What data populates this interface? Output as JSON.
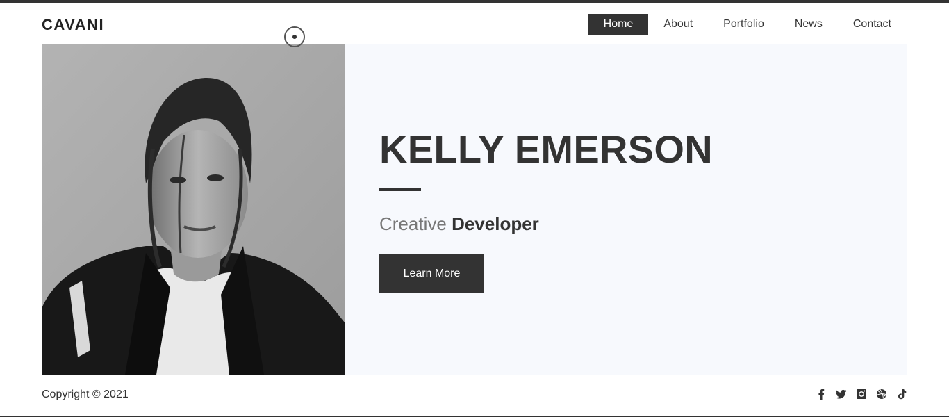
{
  "brand": {
    "name": "CAVANI"
  },
  "nav": {
    "items": [
      {
        "label": "Home",
        "active": true
      },
      {
        "label": "About",
        "active": false
      },
      {
        "label": "Portfolio",
        "active": false
      },
      {
        "label": "News",
        "active": false
      },
      {
        "label": "Contact",
        "active": false
      }
    ]
  },
  "hero": {
    "name": "KELLY EMERSON",
    "job_light": "Creative",
    "job_bold": "Developer",
    "button_label": "Learn More",
    "portrait_icon": "portrait-photo"
  },
  "footer": {
    "copyright": "Copyright © 2021",
    "social": [
      "facebook-icon",
      "twitter-icon",
      "instagram-icon",
      "dribbble-icon",
      "tiktok-icon"
    ]
  },
  "colors": {
    "accent": "#333333",
    "hero_background": "#f7f9fd",
    "muted_text": "#777777"
  }
}
